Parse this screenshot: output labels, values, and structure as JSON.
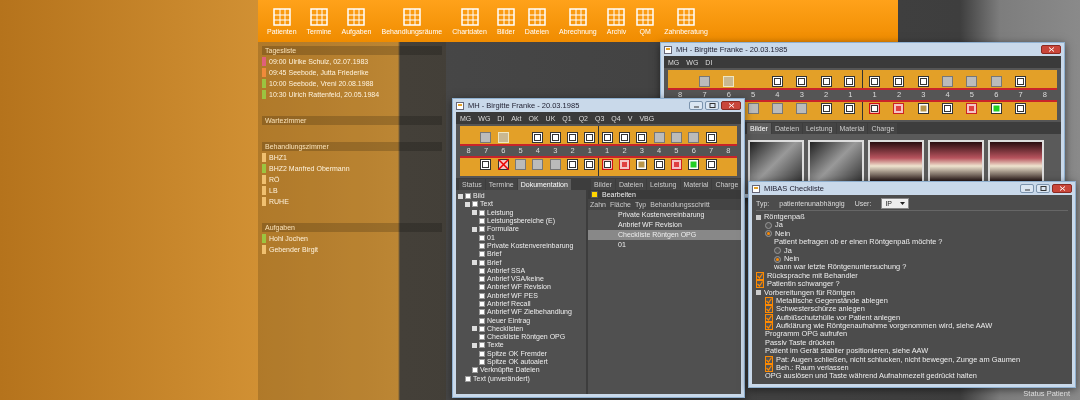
{
  "main_toolbar": {
    "items": [
      "Patienten",
      "Termine",
      "Aufgaben",
      "Behandlungsräume",
      "Chartdaten",
      "Bilder",
      "Dateien",
      "Abrechnung",
      "Archiv",
      "QM",
      "Zahnberatung"
    ]
  },
  "left_panel": {
    "sections": [
      {
        "title": "Tagesliste",
        "rows": [
          {
            "text": "09:00 Ulrike Schulz, 02.07.1983",
            "color": "#e0607a"
          },
          {
            "text": "09:45 Seebode, Jutta Friederike",
            "color": "#f08a3a"
          },
          {
            "text": "10:00 Seebode, Vreni 20.08.1988",
            "color": "#9cc440"
          },
          {
            "text": "10:30 Ulrich Rattenfeld, 20.05.1984",
            "color": "#9cc440"
          }
        ]
      },
      {
        "title": "Wartezimmer"
      },
      {
        "title": "Behandlungszimmer",
        "rows": [
          {
            "text": "BHZ1",
            "color": "#f0c070"
          },
          {
            "text": "BHZ2  Manfred Obermann",
            "color": "#9cc440"
          },
          {
            "text": "RÖ",
            "color": "#f0c070"
          },
          {
            "text": "LB",
            "color": "#f0c070"
          },
          {
            "text": "RUHE",
            "color": "#f0c070"
          }
        ]
      },
      {
        "title": "Aufgaben",
        "rows": [
          {
            "text": "Hohl Jochen",
            "color": "#9cc440"
          },
          {
            "text": "Gebender Birgit",
            "color": "#f0c070"
          }
        ]
      }
    ]
  },
  "window_a": {
    "title": "MH - Birgitte Franke - 20.03.1985",
    "toolbar": [
      "MG",
      "WG",
      "DI"
    ],
    "teeth": {
      "upper": [
        {
          "kind": "none"
        },
        {
          "kind": "missing"
        },
        {
          "kind": "crown"
        },
        {
          "kind": "none"
        },
        {
          "kind": "sound"
        },
        {
          "kind": "sound"
        },
        {
          "kind": "sound"
        },
        {
          "kind": "sound"
        },
        {
          "kind": "sound"
        },
        {
          "kind": "sound"
        },
        {
          "kind": "sound"
        },
        {
          "kind": "missing"
        },
        {
          "kind": "missing"
        },
        {
          "kind": "missing"
        },
        {
          "kind": "sound"
        },
        {
          "kind": "none"
        }
      ],
      "numbers": [
        "8",
        "7",
        "6",
        "5",
        "4",
        "3",
        "2",
        "1",
        "1",
        "2",
        "3",
        "4",
        "5",
        "6",
        "7",
        "8"
      ],
      "lower": [
        {
          "kind": "none"
        },
        {
          "kind": "none"
        },
        {
          "kind": "none"
        },
        {
          "kind": "missing"
        },
        {
          "kind": "missing"
        },
        {
          "kind": "missing"
        },
        {
          "kind": "sound"
        },
        {
          "kind": "sound"
        },
        {
          "kind": "marked"
        },
        {
          "kind": "caries"
        },
        {
          "kind": "filling"
        },
        {
          "kind": "sound"
        },
        {
          "kind": "caries"
        },
        {
          "kind": "green"
        },
        {
          "kind": "sound"
        },
        {
          "kind": "none"
        }
      ]
    },
    "tabs": [
      {
        "label": "Bilder",
        "selected": true
      },
      {
        "label": "Dateien",
        "selected": false
      },
      {
        "label": "Leistung",
        "selected": false
      },
      {
        "label": "Material",
        "selected": false
      },
      {
        "label": "Charge",
        "selected": false
      }
    ],
    "images": [
      {
        "kind": "xray"
      },
      {
        "kind": "xray"
      },
      {
        "kind": "photo"
      },
      {
        "kind": "photo"
      },
      {
        "kind": "photo"
      }
    ]
  },
  "window_b": {
    "title": "MH - Birgitte Franke - 20.03.1985",
    "toolbar": [
      "MG",
      "WG",
      "DI",
      "Akt",
      "OK",
      "UK",
      "Q1",
      "Q2",
      "Q3",
      "Q4",
      "V",
      "VBG"
    ],
    "teeth": {
      "upper": [
        {
          "kind": "none"
        },
        {
          "kind": "missing"
        },
        {
          "kind": "crown"
        },
        {
          "kind": "none"
        },
        {
          "kind": "sound"
        },
        {
          "kind": "sound"
        },
        {
          "kind": "sound"
        },
        {
          "kind": "sound"
        },
        {
          "kind": "sound"
        },
        {
          "kind": "sound"
        },
        {
          "kind": "sound"
        },
        {
          "kind": "missing"
        },
        {
          "kind": "missing"
        },
        {
          "kind": "missing"
        },
        {
          "kind": "sound"
        },
        {
          "kind": "none"
        }
      ],
      "numbers": [
        "8",
        "7",
        "6",
        "5",
        "4",
        "3",
        "2",
        "1",
        "1",
        "2",
        "3",
        "4",
        "5",
        "6",
        "7",
        "8"
      ],
      "lower": [
        {
          "kind": "none"
        },
        {
          "kind": "sound"
        },
        {
          "kind": "extracted"
        },
        {
          "kind": "missing"
        },
        {
          "kind": "missing"
        },
        {
          "kind": "missing"
        },
        {
          "kind": "sound"
        },
        {
          "kind": "sound"
        },
        {
          "kind": "marked"
        },
        {
          "kind": "caries"
        },
        {
          "kind": "filling"
        },
        {
          "kind": "sound"
        },
        {
          "kind": "caries"
        },
        {
          "kind": "green"
        },
        {
          "kind": "sound"
        },
        {
          "kind": "none"
        }
      ]
    },
    "left_tabs": [
      {
        "label": "Status",
        "selected": false
      },
      {
        "label": "Termine",
        "selected": false
      },
      {
        "label": "Dokumentation",
        "selected": true
      }
    ],
    "right_tabs": [
      {
        "label": "Bilder",
        "selected": false
      },
      {
        "label": "Dateien",
        "selected": false
      },
      {
        "label": "Leistung",
        "selected": false
      },
      {
        "label": "Material",
        "selected": false
      },
      {
        "label": "Charge",
        "selected": false
      }
    ],
    "tree": [
      {
        "label": "Bild",
        "children": [
          {
            "label": "Text",
            "children": [
              {
                "label": "Leistung",
                "children": [
                  {
                    "label": "Leistungsbereiche (E)"
                  }
                ]
              },
              {
                "label": "Formulare",
                "children": [
                  {
                    "label": "01"
                  },
                  {
                    "label": "Private Kostenvereinbarung"
                  },
                  {
                    "label": "Brief"
                  }
                ]
              },
              {
                "label": "Brief",
                "children": [
                  {
                    "label": "Anbrief SSA"
                  },
                  {
                    "label": "Anbrief VSA/keine"
                  },
                  {
                    "label": "Anbrief WF Revision"
                  },
                  {
                    "label": "Anbrief WF PES"
                  },
                  {
                    "label": "Anbrief Recall"
                  },
                  {
                    "label": "Anbrief WF Zielbehandlung"
                  },
                  {
                    "label": "Neuer Eintrag"
                  }
                ]
              },
              {
                "label": "Checklisten",
                "children": [
                  {
                    "label": "Checkliste Röntgen OPG"
                  }
                ]
              },
              {
                "label": "Texte",
                "children": [
                  {
                    "label": "Spitze OK Fremder"
                  },
                  {
                    "label": "Spitze OK autoalert"
                  }
                ]
              },
              {
                "label": "Verknüpfte Dateien"
              }
            ]
          },
          {
            "label": "Text (unverändert)"
          }
        ]
      }
    ],
    "steps_header": "Bearbeiten",
    "steps_columns": [
      "Zahn",
      "Fläche",
      "Typ",
      "Behandlungsschritt"
    ],
    "steps": [
      {
        "label": "Private Kostenvereinbarung",
        "selected": false
      },
      {
        "label": "Anbrief WF Revision",
        "selected": false
      },
      {
        "label": "Checkliste Röntgen OPG",
        "selected": true
      },
      {
        "label": "01",
        "selected": false
      }
    ]
  },
  "checklist_window": {
    "title": "MIBAS Checkliste",
    "type_label": "Typ:",
    "type_value": "patientenunabhängig",
    "user_label": "User:",
    "user_value": "IP",
    "items": [
      {
        "kind": "group",
        "label": "Röntgenpaß",
        "children": [
          {
            "kind": "radio",
            "label": "Ja",
            "selected": false
          },
          {
            "kind": "radio",
            "label": "Nein",
            "selected": true,
            "children": [
              {
                "kind": "text",
                "label": "Patient befragen ob er einen Röntgenpaß möchte ?"
              },
              {
                "kind": "radio",
                "label": "Ja",
                "selected": false
              },
              {
                "kind": "radio",
                "label": "Nein",
                "selected": true
              },
              {
                "kind": "text",
                "label": "wann war letzte Röntgenuntersuchung ?"
              }
            ]
          }
        ]
      },
      {
        "kind": "check",
        "label": "Rücksprache mit Behandler",
        "checked": true
      },
      {
        "kind": "check",
        "label": "Patientin schwanger ?",
        "checked": true
      },
      {
        "kind": "group",
        "label": "Vorbereitungen für Röntgen",
        "children": [
          {
            "kind": "check",
            "label": "Metallische Gegenstände ablegen",
            "checked": true
          },
          {
            "kind": "check",
            "label": "Schwesterschürze anlegen",
            "checked": true
          },
          {
            "kind": "check",
            "label": "Aufbißschutzhülle vor Patient anlegen",
            "checked": true
          },
          {
            "kind": "check",
            "label": "Aufklärung wie Röntgenaufnahme vorgenommen wird, siehe AAW",
            "checked": true
          },
          {
            "kind": "text",
            "label": "Programm OPG aufrufen"
          },
          {
            "kind": "text",
            "label": "Passiv Taste drücken"
          },
          {
            "kind": "text",
            "label": "Patient im Gerät stabiler positionieren, siehe AAW"
          },
          {
            "kind": "check",
            "label": "Pat: Augen schließen, nicht schlucken, nicht bewegen, Zunge am Gaumen",
            "checked": true
          },
          {
            "kind": "check",
            "label": "Beh.: Raum verlassen",
            "checked": true
          },
          {
            "kind": "text",
            "label": "OPG auslösen und Taste während Aufnahmezeit gedrückt halten"
          }
        ]
      }
    ]
  },
  "status_bar": {
    "items": [
      "Status Patient"
    ]
  }
}
